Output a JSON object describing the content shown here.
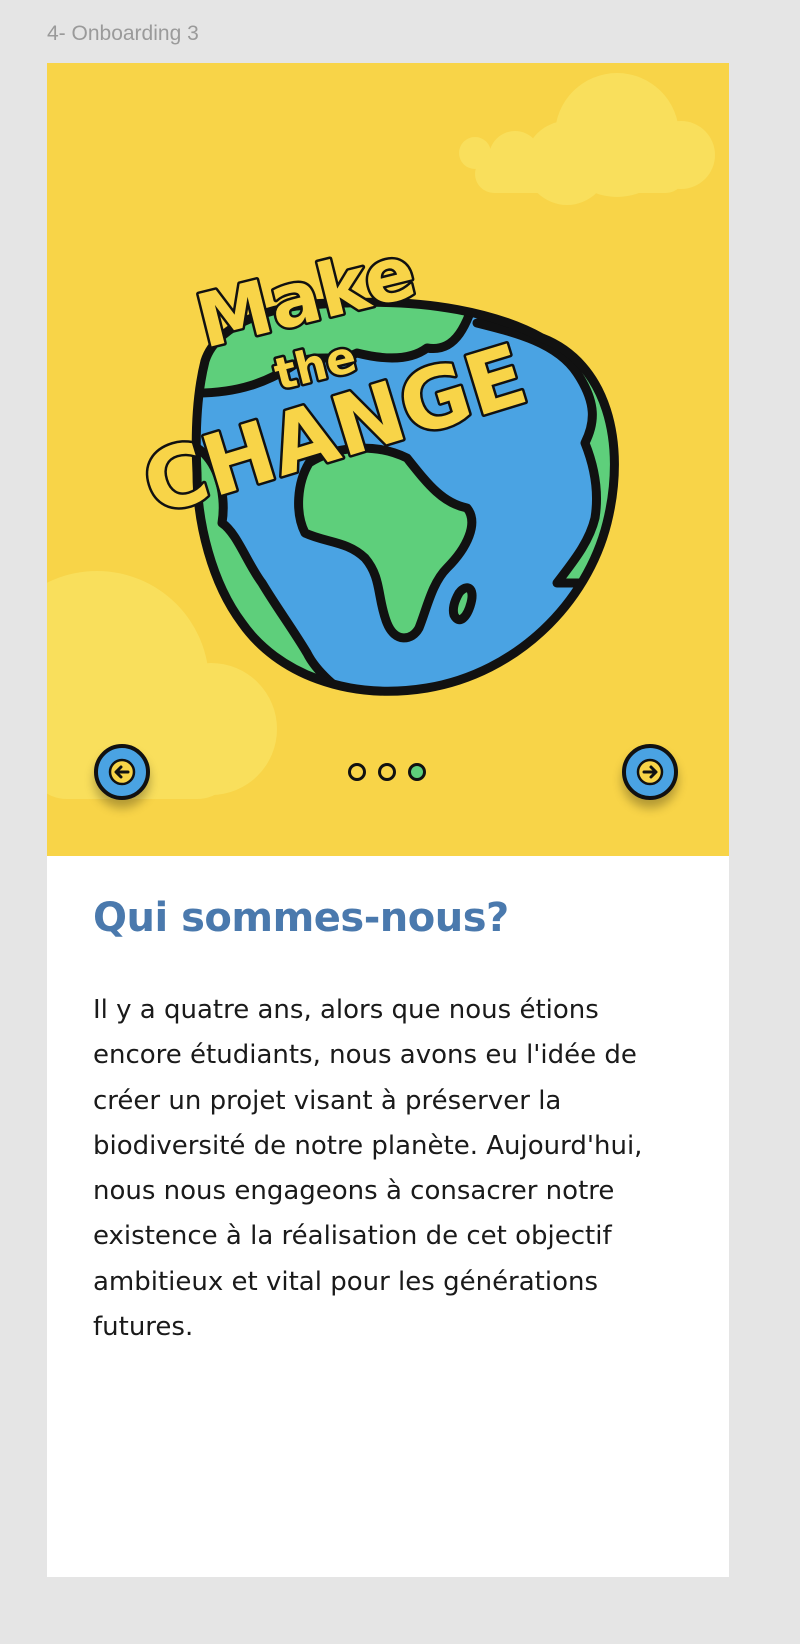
{
  "frame": {
    "label": "4- Onboarding 3"
  },
  "hero": {
    "logo_text": {
      "line1": "Make",
      "line2": "the",
      "line3": "CHANGE"
    },
    "colors": {
      "background": "#f8d448",
      "cloud": "#f9df5c",
      "ocean": "#4aa3e3",
      "land": "#5ecf7b",
      "outline": "#111111"
    },
    "prev_icon": "arrow-left-icon",
    "next_icon": "arrow-right-icon",
    "pagination": {
      "total": 3,
      "current": 3
    }
  },
  "content": {
    "title": "Qui sommes-nous?",
    "lines": [
      "Il y a quatre ans, alors que nous étions",
      "encore étudiants, nous avons eu l'idée de",
      "créer un projet visant à préserver la",
      "biodiversité de notre planète. Aujourd'hui,",
      "nous nous engageons à consacrer notre",
      "existence à la réalisation de cet objectif",
      "ambitieux et vital pour les générations",
      "futures."
    ],
    "title_color": "#4a79ad"
  }
}
